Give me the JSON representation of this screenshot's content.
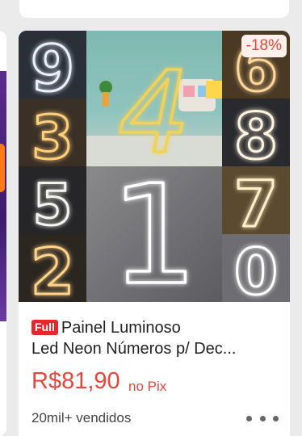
{
  "product": {
    "discount": "-18%",
    "badge": "Full",
    "title_line1": "Painel Luminoso",
    "title_line2": "Led Neon Números p/ Dec...",
    "price": "R$81,90",
    "price_note": "no Pix",
    "sold": "20mil+ vendidos",
    "image_numbers": [
      "9",
      "3",
      "5",
      "2",
      "4",
      "1",
      "6",
      "8",
      "7",
      "0"
    ]
  },
  "colors": {
    "accent": "#e8463a",
    "full_badge": "#e6282e",
    "discount_bg": "#fff0ec"
  },
  "icons": {
    "more": "more-dots-icon"
  }
}
